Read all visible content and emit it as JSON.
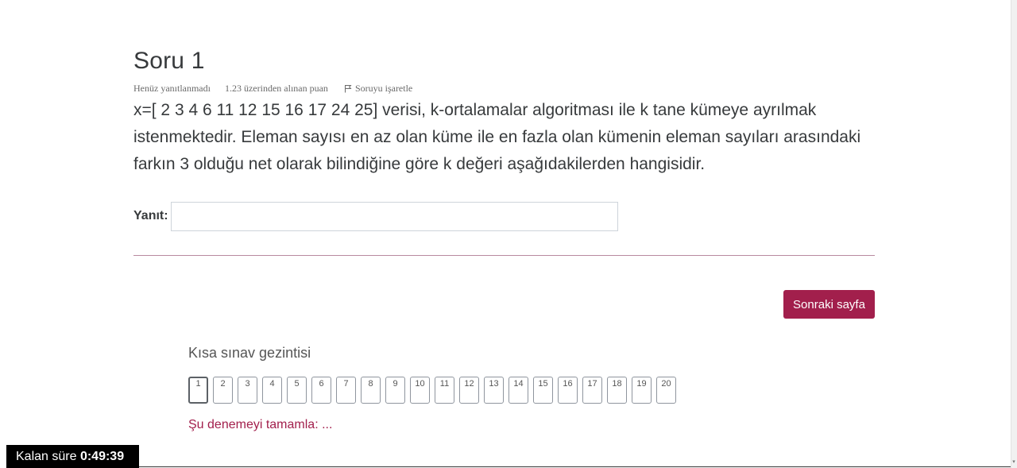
{
  "question": {
    "title": "Soru 1",
    "status": "Henüz yanıtlanmadı",
    "points": "1.23 üzerinden alınan puan",
    "flag_label": "Soruyu işaretle",
    "text": "x=[ 2 3 4 6 11 12 15 16 17 24 25] verisi, k-ortalamalar algoritması ile k tane kümeye ayrılmak istenmektedir. Eleman sayısı en az olan küme ile en fazla olan kümenin eleman sayıları arasındaki farkın 3 olduğu net olarak bilindiğine göre k değeri aşağıdakilerden hangisidir.",
    "answer_label": "Yanıt:",
    "answer_value": ""
  },
  "actions": {
    "next_label": "Sonraki sayfa"
  },
  "navigation": {
    "title": "Kısa sınav gezintisi",
    "current": "1",
    "pages": [
      "1",
      "2",
      "3",
      "4",
      "5",
      "6",
      "7",
      "8",
      "9",
      "10",
      "11",
      "12",
      "13",
      "14",
      "15",
      "16",
      "17",
      "18",
      "19",
      "20"
    ],
    "finish_label": "Şu denemeyi tamamla: ..."
  },
  "timer": {
    "label": "Kalan süre",
    "value": "0:49:39"
  },
  "colors": {
    "accent": "#a21f4c",
    "divider": "#b98aa0",
    "timer_bg": "#000000"
  },
  "icons": {
    "flag": "flag-icon"
  }
}
